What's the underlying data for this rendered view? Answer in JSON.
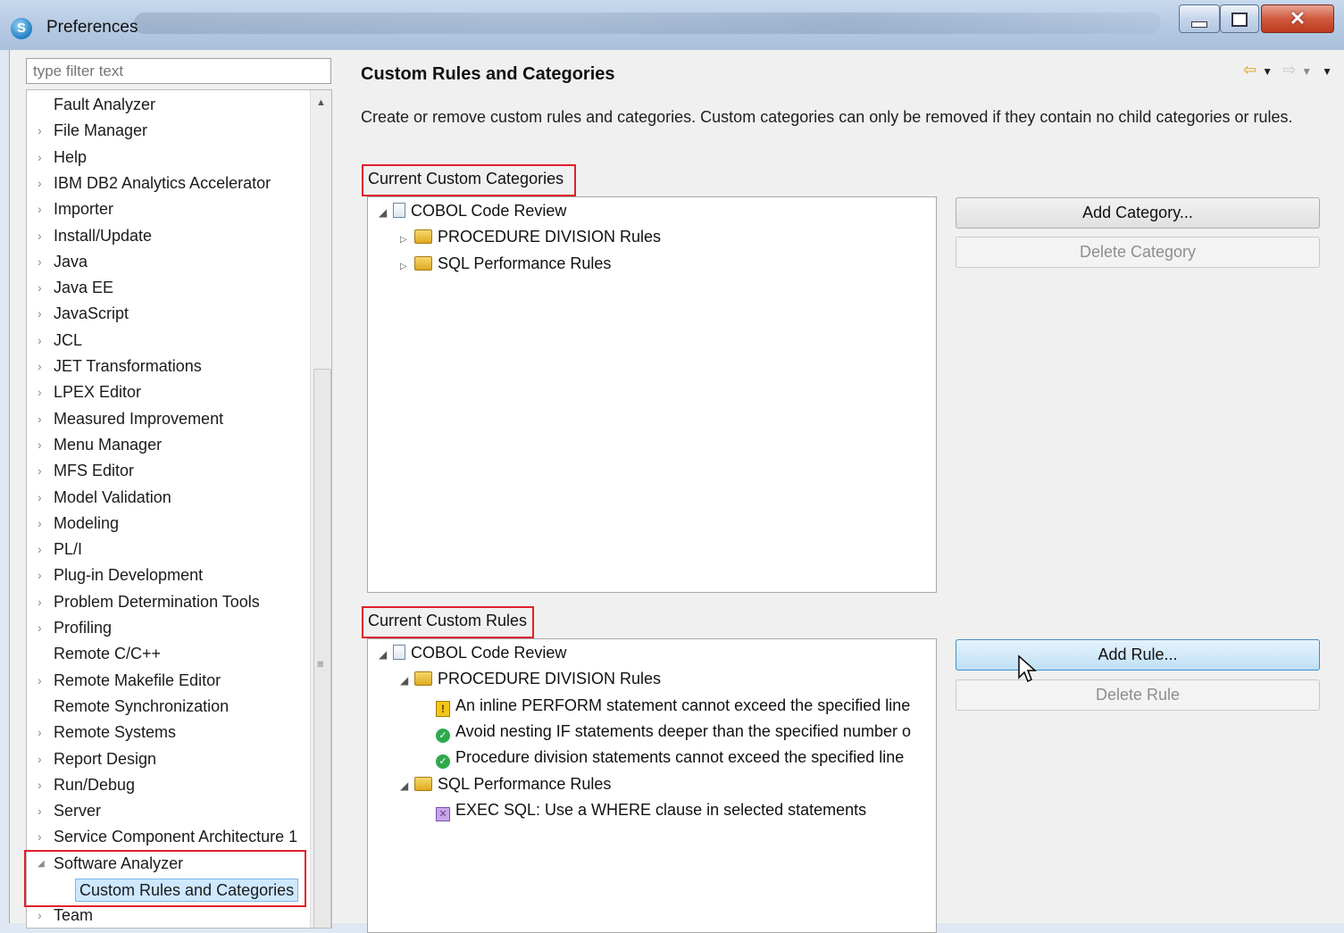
{
  "window": {
    "title": "Preferences"
  },
  "left": {
    "filter_placeholder": "type filter text",
    "items": [
      {
        "label": "Fault Analyzer",
        "expandable": false
      },
      {
        "label": "File Manager",
        "expandable": true
      },
      {
        "label": "Help",
        "expandable": true
      },
      {
        "label": "IBM DB2 Analytics Accelerator",
        "expandable": true
      },
      {
        "label": "Importer",
        "expandable": true
      },
      {
        "label": "Install/Update",
        "expandable": true
      },
      {
        "label": "Java",
        "expandable": true
      },
      {
        "label": "Java EE",
        "expandable": true
      },
      {
        "label": "JavaScript",
        "expandable": true
      },
      {
        "label": "JCL",
        "expandable": true
      },
      {
        "label": "JET Transformations",
        "expandable": true
      },
      {
        "label": "LPEX Editor",
        "expandable": true
      },
      {
        "label": "Measured Improvement",
        "expandable": true
      },
      {
        "label": "Menu Manager",
        "expandable": true
      },
      {
        "label": "MFS Editor",
        "expandable": true
      },
      {
        "label": "Model Validation",
        "expandable": true
      },
      {
        "label": "Modeling",
        "expandable": true
      },
      {
        "label": "PL/I",
        "expandable": true
      },
      {
        "label": "Plug-in Development",
        "expandable": true
      },
      {
        "label": "Problem Determination Tools",
        "expandable": true
      },
      {
        "label": "Profiling",
        "expandable": true
      },
      {
        "label": "Remote C/C++",
        "expandable": false
      },
      {
        "label": "Remote Makefile Editor",
        "expandable": true
      },
      {
        "label": "Remote Synchronization",
        "expandable": false
      },
      {
        "label": "Remote Systems",
        "expandable": true
      },
      {
        "label": "Report Design",
        "expandable": true
      },
      {
        "label": "Run/Debug",
        "expandable": true
      },
      {
        "label": "Server",
        "expandable": true
      },
      {
        "label": "Service Component Architecture 1",
        "expandable": true
      },
      {
        "label": "Software Analyzer",
        "expandable": true,
        "expanded": true
      },
      {
        "label": "Custom Rules and Categories",
        "expandable": false,
        "child": true,
        "selected": true
      },
      {
        "label": "Team",
        "expandable": true
      }
    ]
  },
  "main": {
    "title": "Custom Rules and Categories",
    "description": "Create or remove custom rules and categories.  Custom categories can only be removed if they contain no child categories or rules.",
    "categories_label": "Current Custom Categories",
    "categories_tree": [
      {
        "label": "COBOL Code Review",
        "icon": "document-icon",
        "expander": "expanded",
        "depth": 0
      },
      {
        "label": "PROCEDURE DIVISION Rules",
        "icon": "folder-icon",
        "expander": "collapsed",
        "depth": 1
      },
      {
        "label": "SQL Performance Rules",
        "icon": "folder-icon",
        "expander": "collapsed",
        "depth": 1
      }
    ],
    "add_category": "Add Category...",
    "delete_category": "Delete Category",
    "rules_label": "Current Custom Rules",
    "rules_tree": [
      {
        "label": "COBOL Code Review",
        "icon": "document-icon",
        "expander": "expanded",
        "depth": 0
      },
      {
        "label": "PROCEDURE DIVISION Rules",
        "icon": "folder-icon",
        "expander": "expanded",
        "depth": 1
      },
      {
        "label": "An inline PERFORM statement cannot exceed the specified line",
        "icon": "warning-icon",
        "expander": "none",
        "depth": 2
      },
      {
        "label": "Avoid nesting IF statements deeper than the specified number o",
        "icon": "check-icon",
        "expander": "none",
        "depth": 2
      },
      {
        "label": "Procedure division statements cannot exceed the specified line",
        "icon": "check-icon",
        "expander": "none",
        "depth": 2
      },
      {
        "label": "SQL Performance Rules",
        "icon": "folder-icon",
        "expander": "expanded",
        "depth": 1
      },
      {
        "label": "EXEC SQL: Use a WHERE clause in selected statements",
        "icon": "purple-rule-icon",
        "expander": "none",
        "depth": 2
      }
    ],
    "add_rule": "Add Rule...",
    "delete_rule": "Delete Rule"
  },
  "colors": {
    "highlight_box": "#e0202a",
    "selection": "#cde8ff"
  }
}
